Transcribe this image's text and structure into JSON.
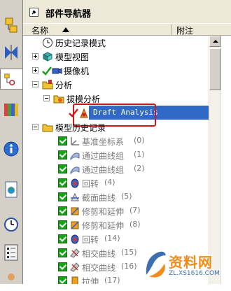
{
  "panel": {
    "title": "部件导航器",
    "columns": {
      "name": "名称",
      "note": "附注"
    }
  },
  "tree": [
    {
      "label": "历史记录模式",
      "num": ""
    },
    {
      "label": "模型视图",
      "num": ""
    },
    {
      "label": "摄像机",
      "num": ""
    },
    {
      "label": "分析",
      "num": ""
    },
    {
      "label": "拔模分析",
      "num": ""
    },
    {
      "label": "Draft Analysis",
      "num": ""
    },
    {
      "label": "模型历史记录",
      "num": ""
    },
    {
      "label": "基准坐标系",
      "num": "(0)"
    },
    {
      "label": "通过曲线组",
      "num": "(1)"
    },
    {
      "label": "通过曲线组",
      "num": "(2)"
    },
    {
      "label": "回转",
      "num": "(4)"
    },
    {
      "label": "截面曲线",
      "num": "(5)"
    },
    {
      "label": "修剪和延伸",
      "num": "(7)"
    },
    {
      "label": "修剪和延伸",
      "num": "(8)"
    },
    {
      "label": "回转",
      "num": "(14)"
    },
    {
      "label": "相交曲线",
      "num": "(15)"
    },
    {
      "label": "相交曲线",
      "num": "(16)"
    },
    {
      "label": "拉伸",
      "num": "(17)"
    }
  ],
  "watermark": {
    "text": "资料网",
    "url": "ZL.XS1616.COM"
  },
  "colors": {
    "selection": "#3169c6",
    "highlight_box": "#d01818",
    "check": "#19a019"
  }
}
